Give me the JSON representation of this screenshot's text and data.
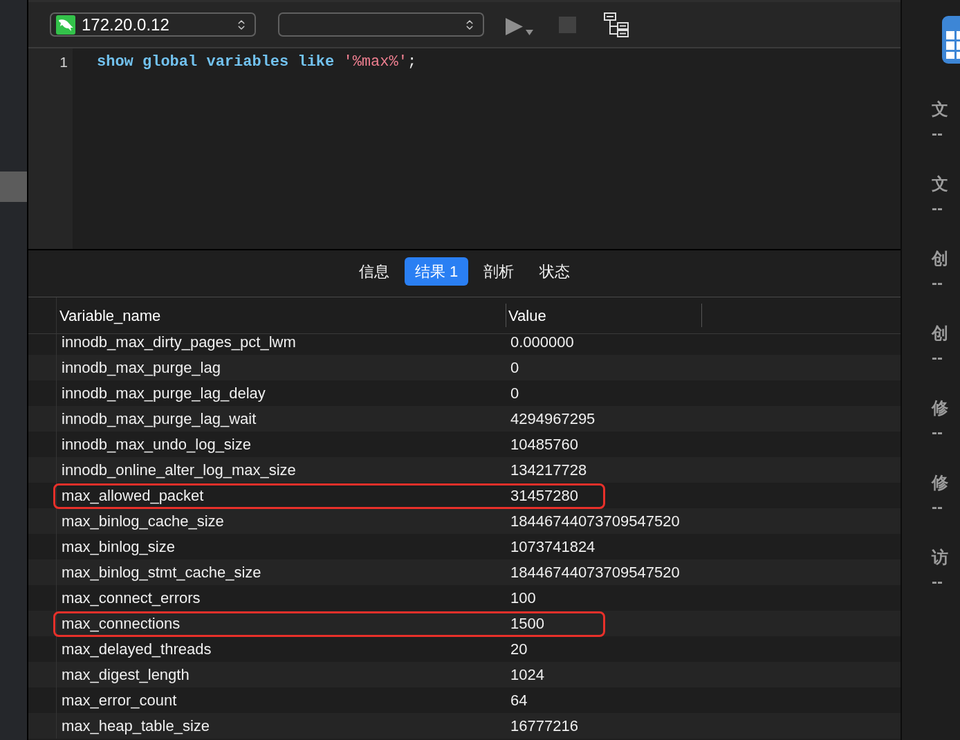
{
  "toolbar": {
    "connection": {
      "value": "172.20.0.12"
    }
  },
  "editor": {
    "lines": [
      {
        "number": "1",
        "tokens": [
          {
            "kind": "keyword",
            "text": "show global variables like "
          },
          {
            "kind": "string",
            "text": "'%max%'"
          },
          {
            "kind": "plain",
            "text": ";"
          }
        ]
      }
    ]
  },
  "result_tabs": [
    {
      "label": "信息",
      "selected": false
    },
    {
      "label": "结果 1",
      "selected": true
    },
    {
      "label": "剖析",
      "selected": false
    },
    {
      "label": "状态",
      "selected": false
    }
  ],
  "table": {
    "columns": [
      "Variable_name",
      "Value"
    ],
    "rows": [
      {
        "name": "innodb_max_dirty_pages_pct_lwm",
        "value": "0.000000",
        "highlighted": false
      },
      {
        "name": "innodb_max_purge_lag",
        "value": "0",
        "highlighted": false
      },
      {
        "name": "innodb_max_purge_lag_delay",
        "value": "0",
        "highlighted": false
      },
      {
        "name": "innodb_max_purge_lag_wait",
        "value": "4294967295",
        "highlighted": false
      },
      {
        "name": "innodb_max_undo_log_size",
        "value": "10485760",
        "highlighted": false
      },
      {
        "name": "innodb_online_alter_log_max_size",
        "value": "134217728",
        "highlighted": false
      },
      {
        "name": "max_allowed_packet",
        "value": "31457280",
        "highlighted": true
      },
      {
        "name": "max_binlog_cache_size",
        "value": "18446744073709547520",
        "highlighted": false
      },
      {
        "name": "max_binlog_size",
        "value": "1073741824",
        "highlighted": false
      },
      {
        "name": "max_binlog_stmt_cache_size",
        "value": "18446744073709547520",
        "highlighted": false
      },
      {
        "name": "max_connect_errors",
        "value": "100",
        "highlighted": false
      },
      {
        "name": "max_connections",
        "value": "1500",
        "highlighted": true
      },
      {
        "name": "max_delayed_threads",
        "value": "20",
        "highlighted": false
      },
      {
        "name": "max_digest_length",
        "value": "1024",
        "highlighted": false
      },
      {
        "name": "max_error_count",
        "value": "64",
        "highlighted": false
      },
      {
        "name": "max_heap_table_size",
        "value": "16777216",
        "highlighted": false
      }
    ]
  },
  "info_panel": {
    "fields": [
      {
        "label": "文",
        "value": "--"
      },
      {
        "label": "文",
        "value": "--"
      },
      {
        "label": "创",
        "value": "--"
      },
      {
        "label": "创",
        "value": "--"
      },
      {
        "label": "修",
        "value": "--"
      },
      {
        "label": "修",
        "value": "--"
      },
      {
        "label": "访",
        "value": "--"
      }
    ]
  }
}
